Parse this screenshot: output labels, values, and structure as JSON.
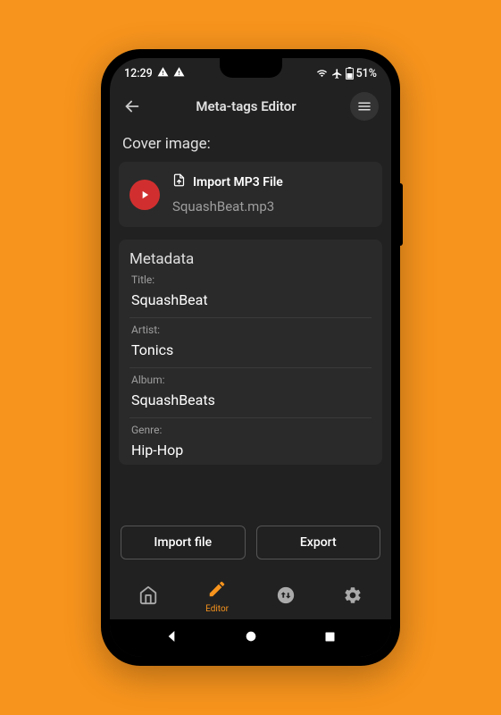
{
  "status": {
    "time": "12:29",
    "battery": "51%"
  },
  "header": {
    "title": "Meta-tags Editor"
  },
  "cover": {
    "section_label": "Cover image:",
    "import_label": "Import MP3 File",
    "filename": "SquashBeat.mp3"
  },
  "metadata": {
    "section_label": "Metadata",
    "title_label": "Title:",
    "title_value": "SquashBeat",
    "artist_label": "Artist:",
    "artist_value": "Tonics",
    "album_label": "Album:",
    "album_value": "SquashBeats",
    "genre_label": "Genre:",
    "genre_value": "Hip-Hop"
  },
  "footer": {
    "import_btn": "Import file",
    "export_btn": "Export"
  },
  "nav": {
    "editor_label": "Editor"
  }
}
